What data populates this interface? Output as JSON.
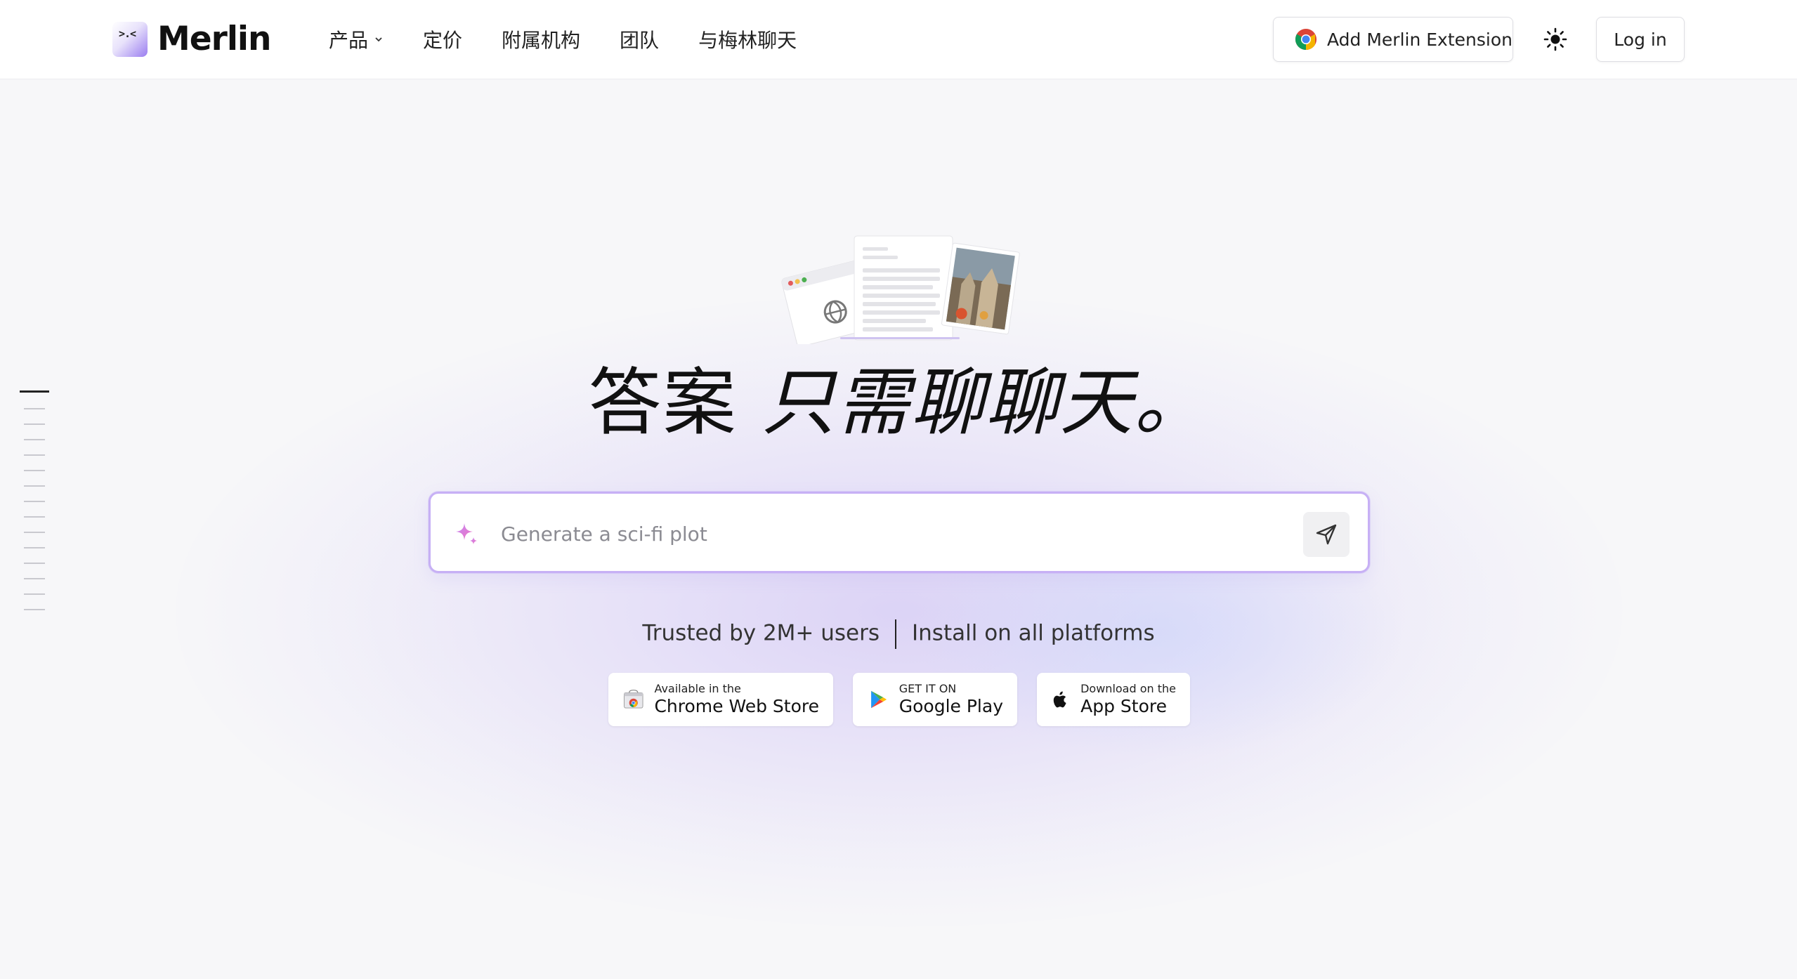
{
  "brand": {
    "name": "Merlin",
    "mark_text": ">.<"
  },
  "nav": {
    "items": [
      {
        "label": "产品",
        "has_dropdown": true
      },
      {
        "label": "定价"
      },
      {
        "label": "附属机构"
      },
      {
        "label": "团队"
      },
      {
        "label": "与梅林聊天"
      }
    ]
  },
  "header": {
    "extension_button": "Add Merlin Extension",
    "theme_icon": "sun-icon",
    "login_button": "Log in"
  },
  "hero": {
    "headline_plain": "答案 ",
    "headline_italic": "只需聊聊天。",
    "search_placeholder": "Generate a sci-fi plot",
    "trusted_text": "Trusted by 2M+ users",
    "install_text": "Install on all platforms"
  },
  "badges": [
    {
      "small": "Available in the",
      "big": "Chrome Web Store",
      "icon": "chrome-web-store-icon"
    },
    {
      "small": "GET IT ON",
      "big": "Google Play",
      "icon": "google-play-icon"
    },
    {
      "small": "Download on the",
      "big": "App Store",
      "icon": "apple-icon"
    }
  ],
  "colors": {
    "accent": "#c7b0f5",
    "background": "#f7f7f9",
    "text": "#111111"
  }
}
